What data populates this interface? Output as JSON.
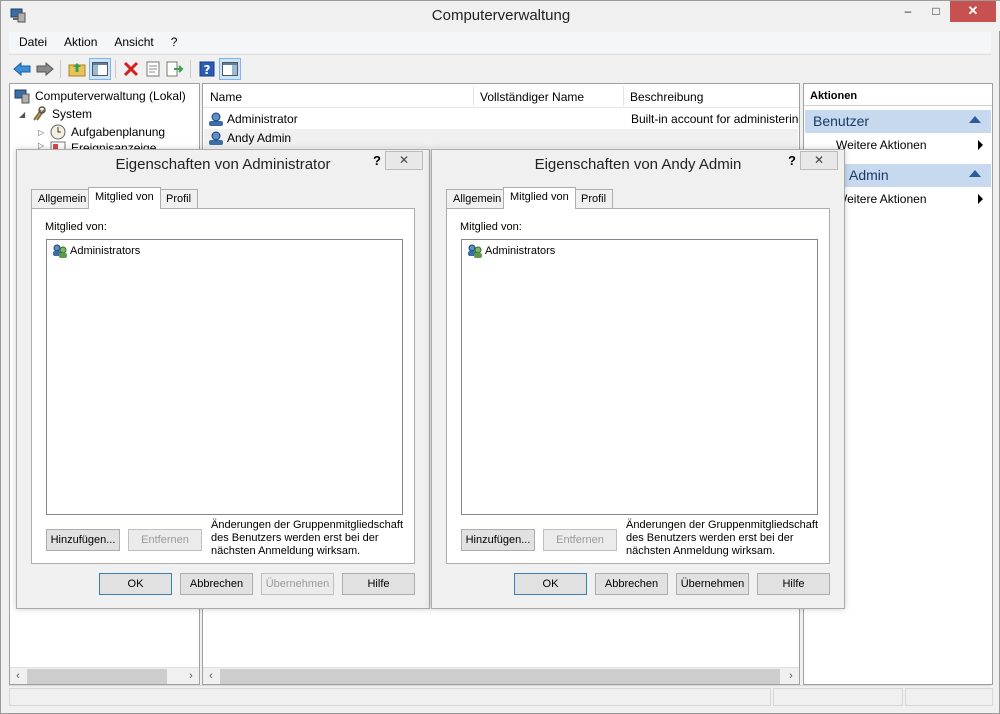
{
  "window": {
    "title": "Computerverwaltung",
    "min": "‒",
    "max": "□",
    "close": "✕"
  },
  "menu": [
    "Datei",
    "Aktion",
    "Ansicht",
    "?"
  ],
  "tree": [
    {
      "label": "Computerverwaltung (Lokal)"
    },
    {
      "label": "System"
    },
    {
      "label": "Aufgabenplanung"
    },
    {
      "label": "Ereignisanzeige"
    }
  ],
  "list": {
    "columns": [
      "Name",
      "Vollständiger Name",
      "Beschreibung"
    ],
    "rows": [
      {
        "name": "Administrator",
        "fullname": "",
        "desc": "Built-in account for administering"
      },
      {
        "name": "Andy Admin",
        "fullname": "",
        "desc": ""
      }
    ]
  },
  "actions": {
    "header": "Aktionen",
    "groups": [
      {
        "title": "Benutzer",
        "item": "Weitere Aktionen"
      },
      {
        "title": "Admin",
        "item": "Weitere Aktionen"
      }
    ]
  },
  "dialogs": [
    {
      "title": "Eigenschaften von Administrator",
      "help": "?",
      "close": "✕",
      "tabs": [
        "Allgemein",
        "Mitglied von",
        "Profil"
      ],
      "member_label": "Mitglied von:",
      "members": [
        "Administrators"
      ],
      "add": "Hinzufügen...",
      "remove": "Entfernen",
      "note": "Änderungen der Gruppenmitgliedschaft des Benutzers werden erst bei der nächsten Anmeldung wirksam.",
      "ok": "OK",
      "cancel": "Abbrechen",
      "apply": "Übernehmen",
      "helpbtn": "Hilfe",
      "apply_enabled": false
    },
    {
      "title": "Eigenschaften von Andy Admin",
      "help": "?",
      "close": "✕",
      "tabs": [
        "Allgemein",
        "Mitglied von",
        "Profil"
      ],
      "member_label": "Mitglied von:",
      "members": [
        "Administrators"
      ],
      "add": "Hinzufügen...",
      "remove": "Entfernen",
      "note": "Änderungen der Gruppenmitgliedschaft des Benutzers werden erst bei der nächsten Anmeldung wirksam.",
      "ok": "OK",
      "cancel": "Abbrechen",
      "apply": "Übernehmen",
      "helpbtn": "Hilfe",
      "apply_enabled": true
    }
  ],
  "icons": [
    "app-icon",
    "back-icon",
    "forward-icon",
    "up-folder-icon",
    "show-hide-tree-icon",
    "delete-icon",
    "properties-icon",
    "export-icon",
    "help-icon",
    "action-pane-icon",
    "user-icon",
    "group-icon"
  ]
}
